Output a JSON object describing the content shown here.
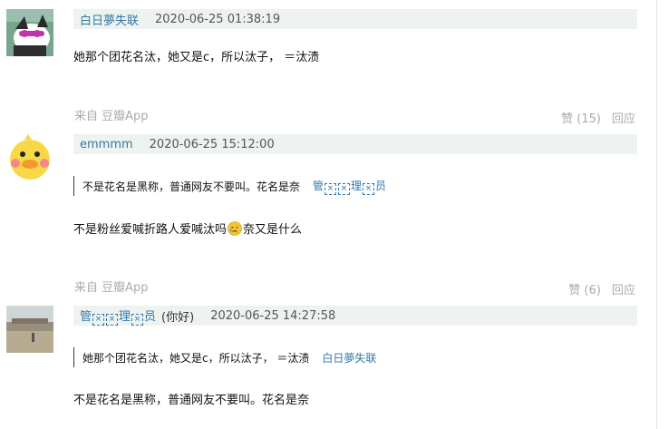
{
  "comments": [
    {
      "author": "白日夢失联",
      "time": "2020-06-25 01:38:19",
      "content": "她那个团花名汰，她又是c，所以汰子， ＝汰渍",
      "from": "来自 豆瓣App",
      "like": "赞 (15)",
      "reply": "回应"
    },
    {
      "author": "emmmm",
      "time": "2020-06-25 15:12:00",
      "quote_text": "不是花名是黑称，普通网友不要叫。花名是奈",
      "quote_author_parts": [
        "管",
        "理",
        "员"
      ],
      "content_before": "不是粉丝爱喊折路人爱喊汰吗",
      "content_after": "奈又是什么",
      "emoji_icon": "crying-face-icon",
      "from": "来自 豆瓣App",
      "like": "赞 (6)",
      "reply": "回应"
    },
    {
      "author_parts": [
        "管",
        "理",
        "员"
      ],
      "author_note": "(你好)",
      "time": "2020-06-25 14:27:58",
      "quote_text": "她那个团花名汰，她又是c，所以汰子， ＝汰渍",
      "quote_author": "白日夢失联",
      "content": "不是花名是黑称，普通网友不要叫。花名是奈"
    }
  ],
  "glyph_x": "×",
  "colors": {
    "link": "#3377aa",
    "bar_bg": "#eef3ef",
    "muted": "#aaaaaa"
  }
}
